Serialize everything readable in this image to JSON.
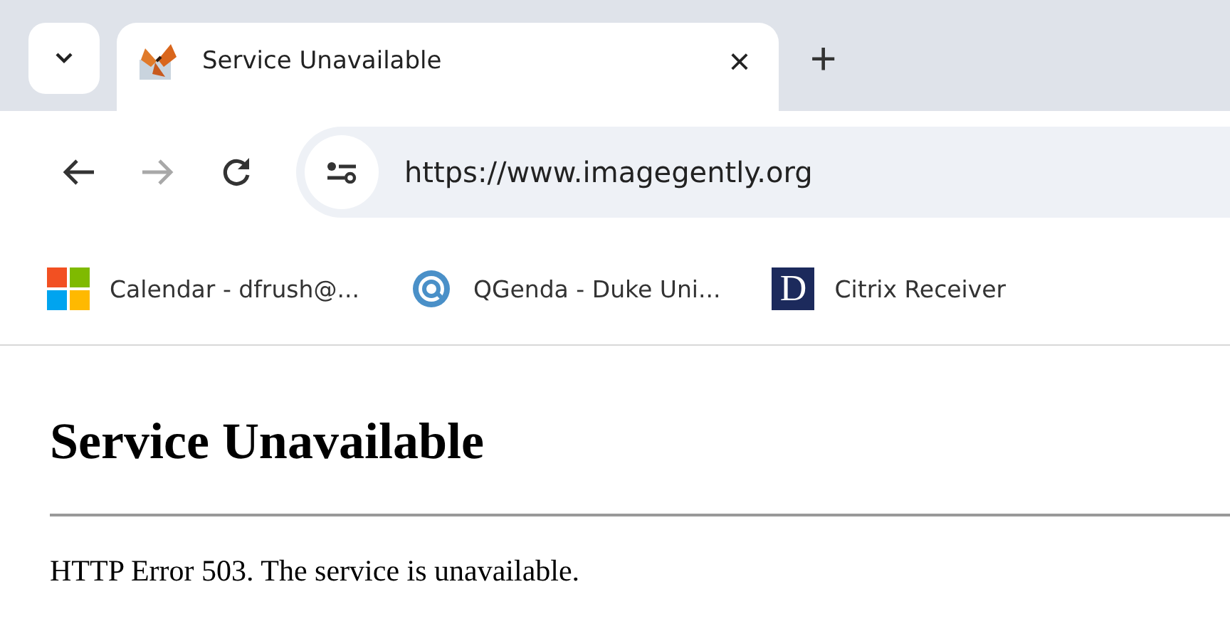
{
  "tabs": [
    {
      "title": "Service Unavailable",
      "close": "×",
      "selected": true
    }
  ],
  "new_tab": "+",
  "address_bar": {
    "url": "https://www.imagegently.org"
  },
  "bookmarks": [
    {
      "kind": "grid",
      "label": "Calendar - dfrush@..."
    },
    {
      "kind": "ring",
      "label": "QGenda - Duke Uni..."
    },
    {
      "kind": "letter",
      "letter": "D",
      "label": "Citrix Receiver"
    }
  ],
  "page": {
    "heading": "Service Unavailable",
    "message": "HTTP Error 503. The service is unavailable."
  }
}
